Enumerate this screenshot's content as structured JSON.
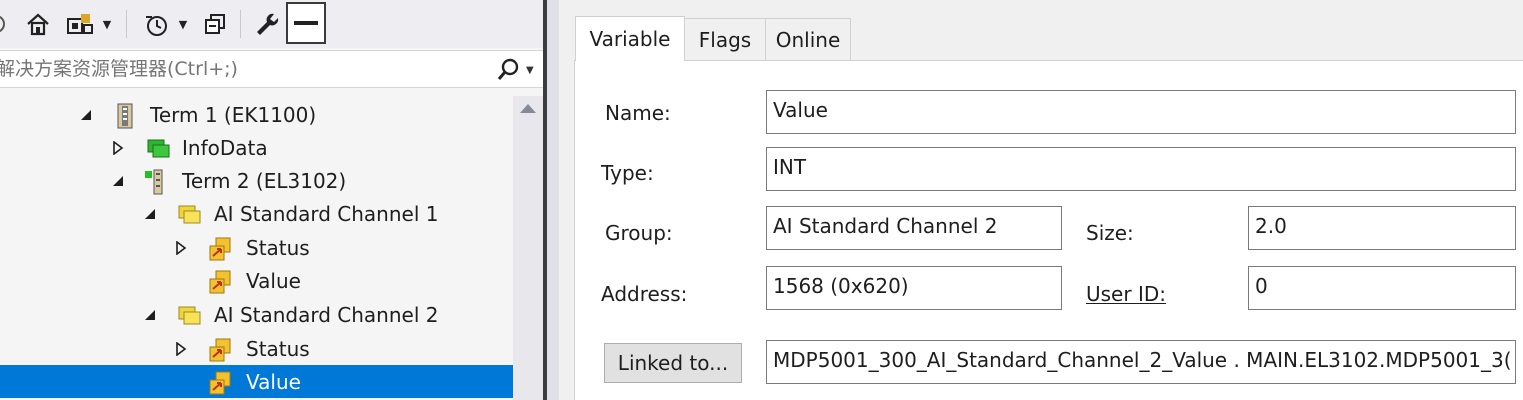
{
  "explorer": {
    "search_placeholder": "解决方案资源管理器(Ctrl+;)",
    "tree": [
      {
        "label": "Term 1 (EK1100)",
        "expander": "expanded",
        "icon": "ek-terminal-icon"
      },
      {
        "label": "InfoData",
        "expander": "collapsed",
        "icon": "green-folder-icon"
      },
      {
        "label": "Term 2 (EL3102)",
        "expander": "expanded",
        "icon": "el-terminal-icon"
      },
      {
        "label": "AI Standard Channel 1",
        "expander": "expanded",
        "icon": "yellow-folder-icon"
      },
      {
        "label": "Status",
        "expander": "collapsed",
        "icon": "input-variable-icon"
      },
      {
        "label": "Value",
        "expander": "none",
        "icon": "input-variable-icon"
      },
      {
        "label": "AI Standard Channel 2",
        "expander": "expanded",
        "icon": "yellow-folder-icon"
      },
      {
        "label": "Status",
        "expander": "collapsed",
        "icon": "input-variable-icon"
      },
      {
        "label": "Value",
        "expander": "none",
        "icon": "input-variable-icon",
        "selected": true
      }
    ]
  },
  "properties": {
    "tabs": [
      "Variable",
      "Flags",
      "Online"
    ],
    "active_tab": "Variable",
    "name_label": "Name:",
    "name_value": "Value",
    "type_label": "Type:",
    "type_value": "INT",
    "group_label": "Group:",
    "group_value": "AI Standard Channel 2",
    "size_label": "Size:",
    "size_value": "2.0",
    "address_label": "Address:",
    "address_value": "1568 (0x620)",
    "userid_label": "User ID:",
    "userid_value": "0",
    "linked_button": "Linked to...",
    "linked_value": "MDP5001_300_AI_Standard_Channel_2_Value . MAIN.EL3102.MDP5001_3("
  },
  "colors": {
    "selection": "#0078d7",
    "panel_bg": "#f0f0f0",
    "tree_bg": "#f5f5f5"
  }
}
